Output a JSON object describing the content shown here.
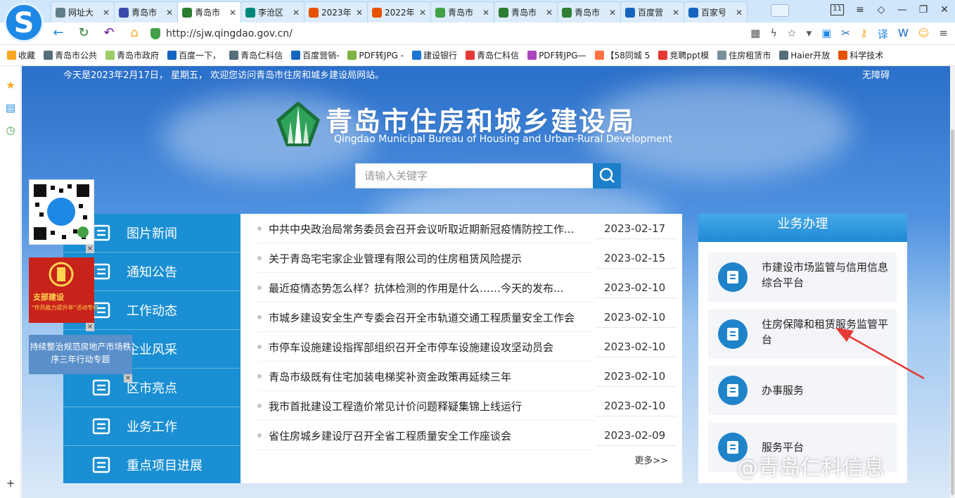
{
  "browser": {
    "tabs": [
      {
        "label": "网址大",
        "color": "#607d8b",
        "active": false
      },
      {
        "label": "青岛市",
        "color": "#3949ab",
        "active": false
      },
      {
        "label": "青岛市",
        "color": "#2e7d32",
        "active": true
      },
      {
        "label": "李沧区",
        "color": "#00897b",
        "active": false
      },
      {
        "label": "2023年",
        "color": "#e65100",
        "active": false
      },
      {
        "label": "2022年",
        "color": "#e65100",
        "active": false
      },
      {
        "label": "青岛市",
        "color": "#43a047",
        "active": false
      },
      {
        "label": "青岛市",
        "color": "#2e7d32",
        "active": false
      },
      {
        "label": "青岛市",
        "color": "#2e7d32",
        "active": false
      },
      {
        "label": "百度营",
        "color": "#1565c0",
        "active": false
      },
      {
        "label": "百家号",
        "color": "#1565c0",
        "active": false
      }
    ],
    "window_badge": "11",
    "url": "http://sjw.qingdao.gov.cn/",
    "bookmarks": [
      {
        "label": "收藏",
        "color": "#f9a825"
      },
      {
        "label": "青岛市公共",
        "color": "#546e7a"
      },
      {
        "label": "青岛市政府",
        "color": "#9ccc65"
      },
      {
        "label": "百度一下，",
        "color": "#1565c0"
      },
      {
        "label": "青岛仁科信",
        "color": "#546e7a"
      },
      {
        "label": "百度营销-",
        "color": "#1565c0"
      },
      {
        "label": "PDF转JPG -",
        "color": "#7cb342"
      },
      {
        "label": "建设银行",
        "color": "#1976d2"
      },
      {
        "label": "青岛仁科信",
        "color": "#e53935"
      },
      {
        "label": "PDF转JPG—",
        "color": "#ab47bc"
      },
      {
        "label": "【58同城 5",
        "color": "#ff7043"
      },
      {
        "label": "竞聘ppt模",
        "color": "#e53935"
      },
      {
        "label": "住房租赁市",
        "color": "#78909c"
      },
      {
        "label": "Haier开放",
        "color": "#546e7a"
      },
      {
        "label": "科学技术",
        "color": "#e65100"
      }
    ]
  },
  "site": {
    "top_notice": "今天是2023年2月17日， 星期五， 欢迎您访问青岛市住房和城乡建设局网站。",
    "accessibility": "无障碍",
    "title_cn": "青岛市住房和城乡建设局",
    "title_en": "Qingdao Municipal Bureau of Housing and Urban-Rural Development",
    "search_placeholder": "请输入关键字",
    "menu": [
      {
        "label": "图片新闻",
        "icon": "picture-icon"
      },
      {
        "label": "通知公告",
        "icon": "notice-icon"
      },
      {
        "label": "工作动态",
        "icon": "work-dynamics-icon"
      },
      {
        "label": "企业风采",
        "icon": "enterprise-icon"
      },
      {
        "label": "区市亮点",
        "icon": "district-icon"
      },
      {
        "label": "业务工作",
        "icon": "business-icon"
      },
      {
        "label": "重点项目进展",
        "icon": "project-icon"
      }
    ],
    "news": [
      {
        "title": "中共中央政治局常务委员会召开会议听取近期新冠疫情防控工作...",
        "date": "2023-02-17"
      },
      {
        "title": "关于青岛宅宅家企业管理有限公司的住房租赁风险提示",
        "date": "2023-02-15"
      },
      {
        "title": "最近疫情态势怎么样？抗体检测的作用是什么……今天的发布...",
        "date": "2023-02-10"
      },
      {
        "title": "市城乡建设安全生产专委会召开全市轨道交通工程质量安全工作会",
        "date": "2023-02-10"
      },
      {
        "title": "市停车设施建设指挥部组织召开全市停车设施建设攻坚动员会",
        "date": "2023-02-10"
      },
      {
        "title": "青岛市级既有住宅加装电梯奖补资金政策再延续三年",
        "date": "2023-02-10"
      },
      {
        "title": "我市首批建设工程造价常见计价问题释疑集锦上线运行",
        "date": "2023-02-10"
      },
      {
        "title": "省住房城乡建设厅召开全省工程质量安全工作座谈会",
        "date": "2023-02-09"
      }
    ],
    "more": "更多>>",
    "biz_title": "业务办理",
    "biz_items": [
      {
        "label": "市建设市场监管与信用信息综合平台"
      },
      {
        "label": "住房保障和租赁服务监管平台"
      },
      {
        "label": "办事服务"
      },
      {
        "label": "服务平台"
      }
    ],
    "float_red_title": "支部建设",
    "float_red_sub": "\"作风能力提升年\"活动专栏",
    "float_blue_text": "持续整治规范房地产市场秩序三年行动专题",
    "close_mark": "×"
  },
  "watermark": "@青岛仁科信息"
}
